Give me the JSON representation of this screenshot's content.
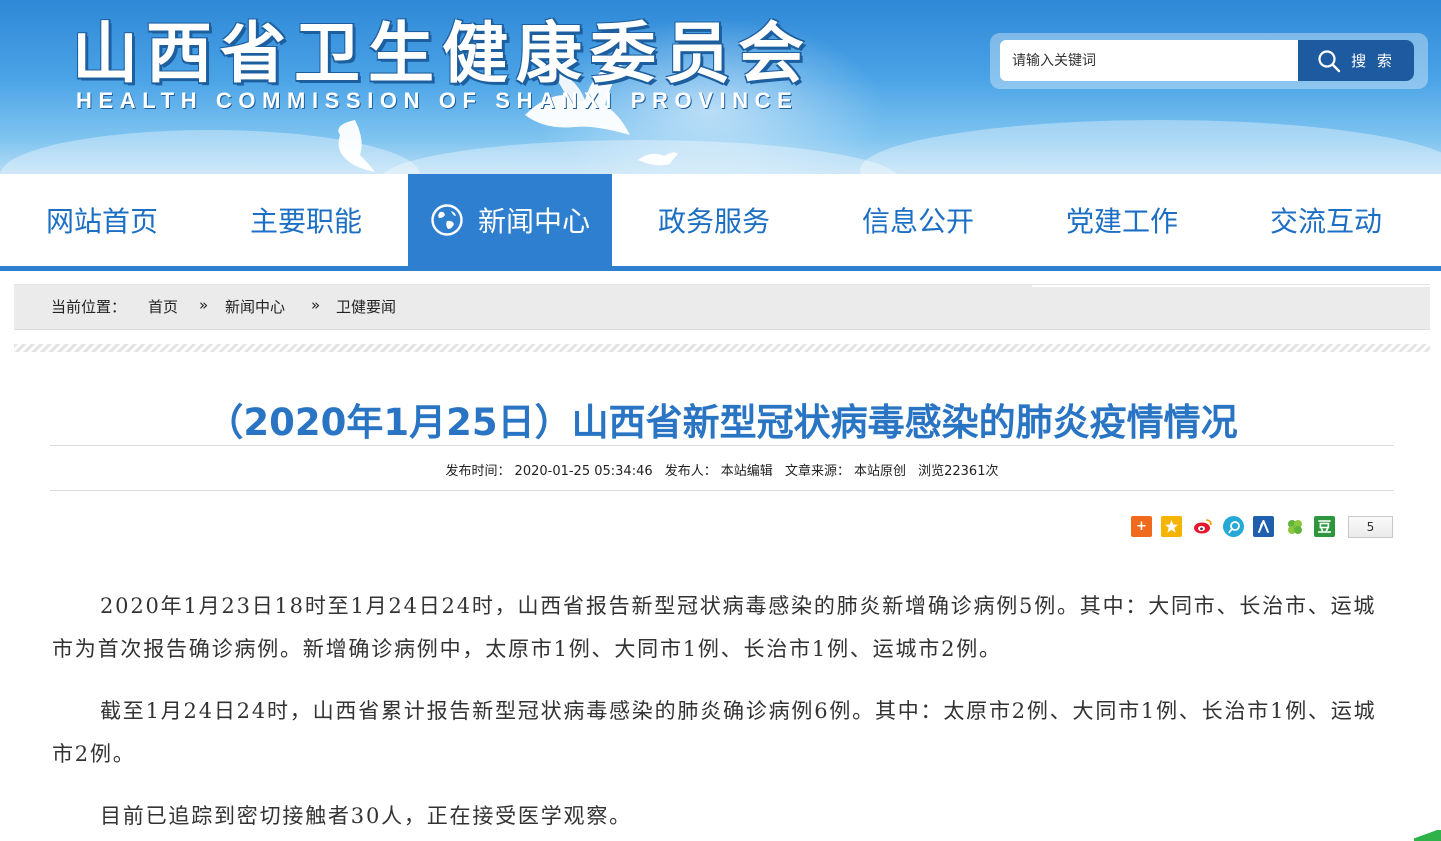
{
  "header": {
    "title": "山西省卫生健康委员会",
    "subtitle": "HEALTH COMMISSION OF SHANXI PROVINCE"
  },
  "search": {
    "placeholder": "请输入关键词",
    "button_label": "搜 索"
  },
  "nav": {
    "items": [
      {
        "label": "网站首页"
      },
      {
        "label": "主要职能"
      },
      {
        "label": "新闻中心",
        "active": true
      },
      {
        "label": "政务服务"
      },
      {
        "label": "信息公开"
      },
      {
        "label": "党建工作"
      },
      {
        "label": "交流互动"
      }
    ]
  },
  "breadcrumb": {
    "prefix": "当前位置：",
    "items": [
      "首页",
      "新闻中心",
      "卫健要闻"
    ],
    "separator": "»"
  },
  "article": {
    "title": "（2020年1月25日）山西省新型冠状病毒感染的肺炎疫情情况",
    "meta": {
      "publish_label": "发布时间：",
      "publish_time": "2020-01-25 05:34:46",
      "author_label": "发布人：",
      "author": "本站编辑",
      "source_label": "文章来源：",
      "source": "本站原创",
      "views": "浏览22361次"
    },
    "share": {
      "icons": [
        "add-share",
        "qzone",
        "weibo",
        "tencent-weibo",
        "renren",
        "kaixin",
        "douban"
      ],
      "count": "5"
    },
    "paragraphs": [
      "2020年1月23日18时至1月24日24时，山西省报告新型冠状病毒感染的肺炎新增确诊病例5例。其中：大同市、长治市、运城市为首次报告确诊病例。新增确诊病例中，太原市1例、大同市1例、长治市1例、运城市2例。",
      "截至1月24日24时，山西省累计报告新型冠状病毒感染的肺炎确诊病例6例。其中：太原市2例、大同市1例、长治市1例、运城市2例。",
      "目前已追踪到密切接触者30人，正在接受医学观察。"
    ]
  },
  "colors": {
    "brand_blue": "#2f7fd0",
    "title_blue": "#2a74c4",
    "search_button": "#1e5aa0"
  }
}
